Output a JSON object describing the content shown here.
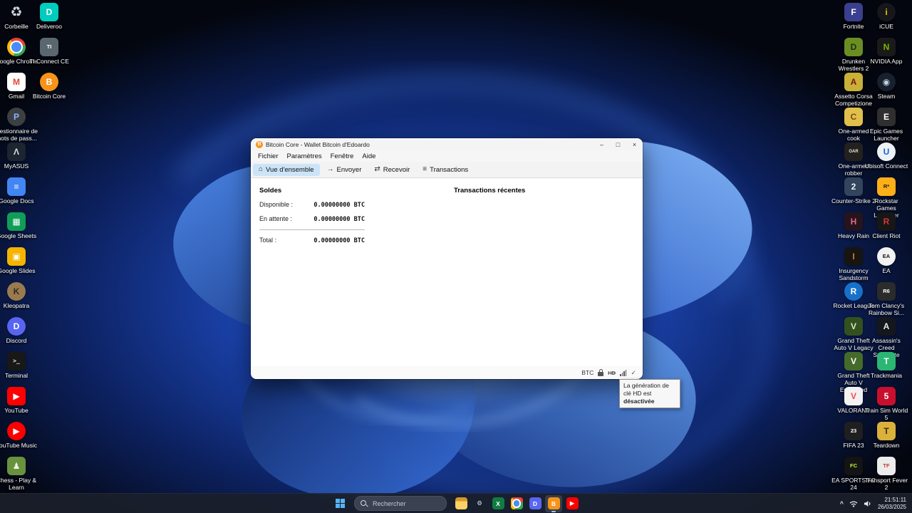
{
  "colors": {
    "bitcoin_orange": "#f7931a",
    "tab_active_bg": "#cce4f7",
    "taskbar_bg": "#1a1f2b"
  },
  "desktop": {
    "left_primary": [
      {
        "name": "shortcut-corbeille",
        "label": "Corbeille",
        "icon": "recycle-bin-icon",
        "glyph": "♻",
        "bg": "transparent",
        "fg": "#cfd8e0"
      },
      {
        "name": "shortcut-google-chrome",
        "label": "Google Chrome",
        "icon": "chrome-icon",
        "glyph": "",
        "bg": "",
        "fg": ""
      },
      {
        "name": "shortcut-gmail",
        "label": "Gmail",
        "icon": "gmail-icon",
        "glyph": "M",
        "bg": "#ffffff",
        "fg": "#ea4335"
      },
      {
        "name": "shortcut-password-manager",
        "label": "Gestionnaire de mots de pass...",
        "icon": "password-manager-icon",
        "glyph": "P",
        "bg": "#3c4043",
        "fg": "#8ab4f8"
      },
      {
        "name": "shortcut-myasus",
        "label": "MyASUS",
        "icon": "myasus-icon",
        "glyph": "Λ",
        "bg": "#1c2530",
        "fg": "#d8dee6"
      },
      {
        "name": "shortcut-google-docs",
        "label": "Google Docs",
        "icon": "google-docs-icon",
        "glyph": "≡",
        "bg": "#4285f4",
        "fg": "#ffffff"
      },
      {
        "name": "shortcut-google-sheets",
        "label": "Google Sheets",
        "icon": "google-sheets-icon",
        "glyph": "▦",
        "bg": "#0f9d58",
        "fg": "#ffffff"
      },
      {
        "name": "shortcut-google-slides",
        "label": "Google Slides",
        "icon": "google-slides-icon",
        "glyph": "▣",
        "bg": "#f4b400",
        "fg": "#ffffff"
      },
      {
        "name": "shortcut-kleopatra",
        "label": "Kleopatra",
        "icon": "kleopatra-icon",
        "glyph": "K",
        "bg": "#9a7b4f",
        "fg": "#2e2a22"
      },
      {
        "name": "shortcut-discord",
        "label": "Discord",
        "icon": "discord-icon",
        "glyph": "D",
        "bg": "#5865f2",
        "fg": "#ffffff"
      },
      {
        "name": "shortcut-terminal",
        "label": "Terminal",
        "icon": "terminal-icon",
        "glyph": ">_",
        "bg": "#181818",
        "fg": "#e6e6e6"
      },
      {
        "name": "shortcut-youtube",
        "label": "YouTube",
        "icon": "youtube-icon",
        "glyph": "▶",
        "bg": "#ff0000",
        "fg": "#ffffff"
      },
      {
        "name": "shortcut-youtube-music",
        "label": "YouTube Music",
        "icon": "youtube-music-icon",
        "glyph": "▶",
        "bg": "#ff0000",
        "fg": "#ffffff"
      },
      {
        "name": "shortcut-chess",
        "label": "Chess - Play & Learn",
        "icon": "chess-icon",
        "glyph": "♟",
        "bg": "#69923e",
        "fg": "#f5f1e6"
      }
    ],
    "left_secondary": [
      {
        "name": "shortcut-deliveroo",
        "label": "Deliveroo",
        "icon": "deliveroo-icon",
        "glyph": "D",
        "bg": "#00ccbc",
        "fg": "#ffffff"
      },
      {
        "name": "shortcut-ti-connect",
        "label": "TI Connect CE",
        "icon": "ti-connect-icon",
        "glyph": "TI",
        "bg": "#5b6770",
        "fg": "#ffffff"
      },
      {
        "name": "shortcut-bitcoin-core",
        "label": "Bitcoin Core",
        "icon": "bitcoin-core-icon",
        "glyph": "B",
        "bg": "#f7931a",
        "fg": "#ffffff"
      }
    ],
    "right_inner": [
      {
        "name": "shortcut-fortnite",
        "label": "Fortnite",
        "icon": "fortnite-icon",
        "glyph": "F",
        "bg": "#3b3f8f",
        "fg": "#ffffff"
      },
      {
        "name": "shortcut-drunken-wrestlers",
        "label": "Drunken Wrestlers 2",
        "icon": "drunken-wrestlers-icon",
        "glyph": "D",
        "bg": "#6b8e23",
        "fg": "#22310d"
      },
      {
        "name": "shortcut-assetto-corsa",
        "label": "Assetto Corsa Competizione",
        "icon": "assetto-corsa-icon",
        "glyph": "A",
        "bg": "#c9b037",
        "fg": "#7c1212"
      },
      {
        "name": "shortcut-one-armed-cook",
        "label": "One-armed cook",
        "icon": "one-armed-cook-icon",
        "glyph": "C",
        "bg": "#e0c04a",
        "fg": "#7a4a12"
      },
      {
        "name": "shortcut-one-armed-robber",
        "label": "One-armed robber",
        "icon": "one-armed-robber-icon",
        "glyph": "OAR",
        "bg": "#23211f",
        "fg": "#e8e3d8"
      },
      {
        "name": "shortcut-counter-strike-2",
        "label": "Counter-Strike 2",
        "icon": "counter-strike-2-icon",
        "glyph": "2",
        "bg": "#32455c",
        "fg": "#f0f0f0"
      },
      {
        "name": "shortcut-heavy-rain",
        "label": "Heavy Rain",
        "icon": "heavy-rain-icon",
        "glyph": "H",
        "bg": "#26141c",
        "fg": "#e06a8a"
      },
      {
        "name": "shortcut-insurgency",
        "label": "Insurgency Sandstorm",
        "icon": "insurgency-icon",
        "glyph": "I",
        "bg": "#171512",
        "fg": "#e07820"
      },
      {
        "name": "shortcut-rocket-league",
        "label": "Rocket League",
        "icon": "rocket-league-icon",
        "glyph": "R",
        "bg": "#1871c9",
        "fg": "#ffffff"
      },
      {
        "name": "shortcut-gta-v-legacy",
        "label": "Grand Theft Auto V Legacy",
        "icon": "gta-v-legacy-icon",
        "glyph": "V",
        "bg": "#33511f",
        "fg": "#d8e8c0"
      },
      {
        "name": "shortcut-gta-v-enhanced",
        "label": "Grand Theft Auto V Enhanced",
        "icon": "gta-v-enhanced-icon",
        "glyph": "V",
        "bg": "#456b2a",
        "fg": "#ffffff"
      },
      {
        "name": "shortcut-valorant",
        "label": "VALORANT",
        "icon": "valorant-icon",
        "glyph": "V",
        "bg": "#f2f2f2",
        "fg": "#ff4655"
      },
      {
        "name": "shortcut-fifa-23",
        "label": "FIFA 23",
        "icon": "fifa-23-icon",
        "glyph": "23",
        "bg": "#1f1f1f",
        "fg": "#ffffff"
      },
      {
        "name": "shortcut-ea-fc-24",
        "label": "EA SPORTS FC 24",
        "icon": "ea-fc-24-icon",
        "glyph": "FC",
        "bg": "#141414",
        "fg": "#c1f53a"
      }
    ],
    "right_outer": [
      {
        "name": "shortcut-icue",
        "label": "iCUE",
        "icon": "icue-icon",
        "glyph": "i",
        "bg": "#15171a",
        "fg": "#f2c200"
      },
      {
        "name": "shortcut-nvidia-app",
        "label": "NVIDIA App",
        "icon": "nvidia-icon",
        "glyph": "N",
        "bg": "#1a1a1a",
        "fg": "#76b900"
      },
      {
        "name": "shortcut-steam",
        "label": "Steam",
        "icon": "steam-icon",
        "glyph": "◉",
        "bg": "#17202d",
        "fg": "#c5d6e8"
      },
      {
        "name": "shortcut-epic-games",
        "label": "Epic Games Launcher",
        "icon": "epic-games-icon",
        "glyph": "E",
        "bg": "#2f2f2f",
        "fg": "#ffffff"
      },
      {
        "name": "shortcut-ubisoft-connect",
        "label": "Ubisoft Connect",
        "icon": "ubisoft-icon",
        "glyph": "U",
        "bg": "#eef1f4",
        "fg": "#1464dc"
      },
      {
        "name": "shortcut-rockstar",
        "label": "Rockstar Games Launcher",
        "icon": "rockstar-icon",
        "glyph": "R*",
        "bg": "#fcaf17",
        "fg": "#1a1a1a"
      },
      {
        "name": "shortcut-client-riot",
        "label": "Client Riot",
        "icon": "riot-client-icon",
        "glyph": "R",
        "bg": "#171717",
        "fg": "#d13639"
      },
      {
        "name": "shortcut-ea",
        "label": "EA",
        "icon": "ea-icon",
        "glyph": "EA",
        "bg": "#f2f2f2",
        "fg": "#141414"
      },
      {
        "name": "shortcut-rainbow-six",
        "label": "Tom Clancy's Rainbow Si...",
        "icon": "rainbow-six-icon",
        "glyph": "R6",
        "bg": "#2b2b2b",
        "fg": "#ffffff"
      },
      {
        "name": "shortcut-ac-syndicate",
        "label": "Assassin's Creed Syndicate",
        "icon": "ac-syndicate-icon",
        "glyph": "A",
        "bg": "#14181c",
        "fg": "#e8e8e8"
      },
      {
        "name": "shortcut-trackmania",
        "label": "Trackmania",
        "icon": "trackmania-icon",
        "glyph": "T",
        "bg": "#2bb673",
        "fg": "#ffffff"
      },
      {
        "name": "shortcut-train-sim-world-5",
        "label": "Train Sim World 5",
        "icon": "tsw5-icon",
        "glyph": "5",
        "bg": "#c8102e",
        "fg": "#ffffff"
      },
      {
        "name": "shortcut-teardown",
        "label": "Teardown",
        "icon": "teardown-icon",
        "glyph": "T",
        "bg": "#d9b13b",
        "fg": "#3a2c12"
      },
      {
        "name": "shortcut-transport-fever-2",
        "label": "Transport Fever 2",
        "icon": "transport-fever-icon",
        "glyph": "TF",
        "bg": "#ececec",
        "fg": "#c0392b"
      }
    ]
  },
  "window": {
    "title": "Bitcoin Core - Wallet Bitcoin d'Edoardo",
    "badge_glyph": "B",
    "controls": {
      "minimize": "–",
      "maximize": "□",
      "close": "×"
    },
    "menu": [
      {
        "name": "menu-fichier",
        "label": "Fichier"
      },
      {
        "name": "menu-parametres",
        "label": "Paramètres"
      },
      {
        "name": "menu-fenetre",
        "label": "Fenêtre"
      },
      {
        "name": "menu-aide",
        "label": "Aide"
      }
    ],
    "tabs": [
      {
        "name": "tab-vue-densemble",
        "label": "Vue d'ensemble",
        "icon": "overview-icon",
        "glyph": "⌂",
        "state": "active"
      },
      {
        "name": "tab-envoyer",
        "label": "Envoyer",
        "icon": "send-icon",
        "glyph": "→",
        "state": ""
      },
      {
        "name": "tab-recevoir",
        "label": "Recevoir",
        "icon": "receive-icon",
        "glyph": "⇄",
        "state": ""
      },
      {
        "name": "tab-transactions",
        "label": "Transactions",
        "icon": "transactions-icon",
        "glyph": "≡",
        "state": ""
      }
    ],
    "balances": {
      "header": "Soldes",
      "rows": [
        {
          "label": "Disponible :",
          "value": "0.00000000 BTC"
        },
        {
          "label": "En attente :",
          "value": "0.00000000 BTC"
        }
      ],
      "total_row": {
        "label": "Total :",
        "value": "0.00000000 BTC"
      }
    },
    "transactions": {
      "header": "Transactions récentes"
    },
    "statusbar": {
      "unit": "BTC",
      "hd": "HD",
      "check": "✓"
    }
  },
  "tooltip": {
    "text": "La génération de clé HD est ",
    "bold": "désactivée"
  },
  "taskbar": {
    "search": {
      "placeholder": "Rechercher"
    },
    "apps": [
      {
        "name": "taskbar-file-explorer",
        "icon": "file-explorer-icon",
        "glyph": "",
        "bg": "",
        "fg": "",
        "state": ""
      },
      {
        "name": "taskbar-settings",
        "icon": "settings-icon",
        "glyph": "⚙",
        "bg": "transparent",
        "fg": "#dfe3e8",
        "state": ""
      },
      {
        "name": "taskbar-excel",
        "icon": "excel-icon",
        "glyph": "X",
        "bg": "#107c41",
        "fg": "#ffffff",
        "state": ""
      },
      {
        "name": "taskbar-chrome",
        "icon": "chrome-icon",
        "glyph": "",
        "bg": "",
        "fg": "",
        "state": ""
      },
      {
        "name": "taskbar-discord",
        "icon": "discord-icon",
        "glyph": "D",
        "bg": "#5865f2",
        "fg": "#ffffff",
        "state": ""
      },
      {
        "name": "taskbar-bitcoin-core",
        "icon": "bitcoin-core-icon",
        "glyph": "B",
        "bg": "#f7931a",
        "fg": "#ffffff",
        "state": "active"
      },
      {
        "name": "taskbar-youtube",
        "icon": "youtube-icon",
        "glyph": "▶",
        "bg": "#ff0000",
        "fg": "#ffffff",
        "state": ""
      }
    ],
    "tray": {
      "chevron": "^",
      "time": "21:51:11",
      "date": "26/03/2025"
    }
  }
}
